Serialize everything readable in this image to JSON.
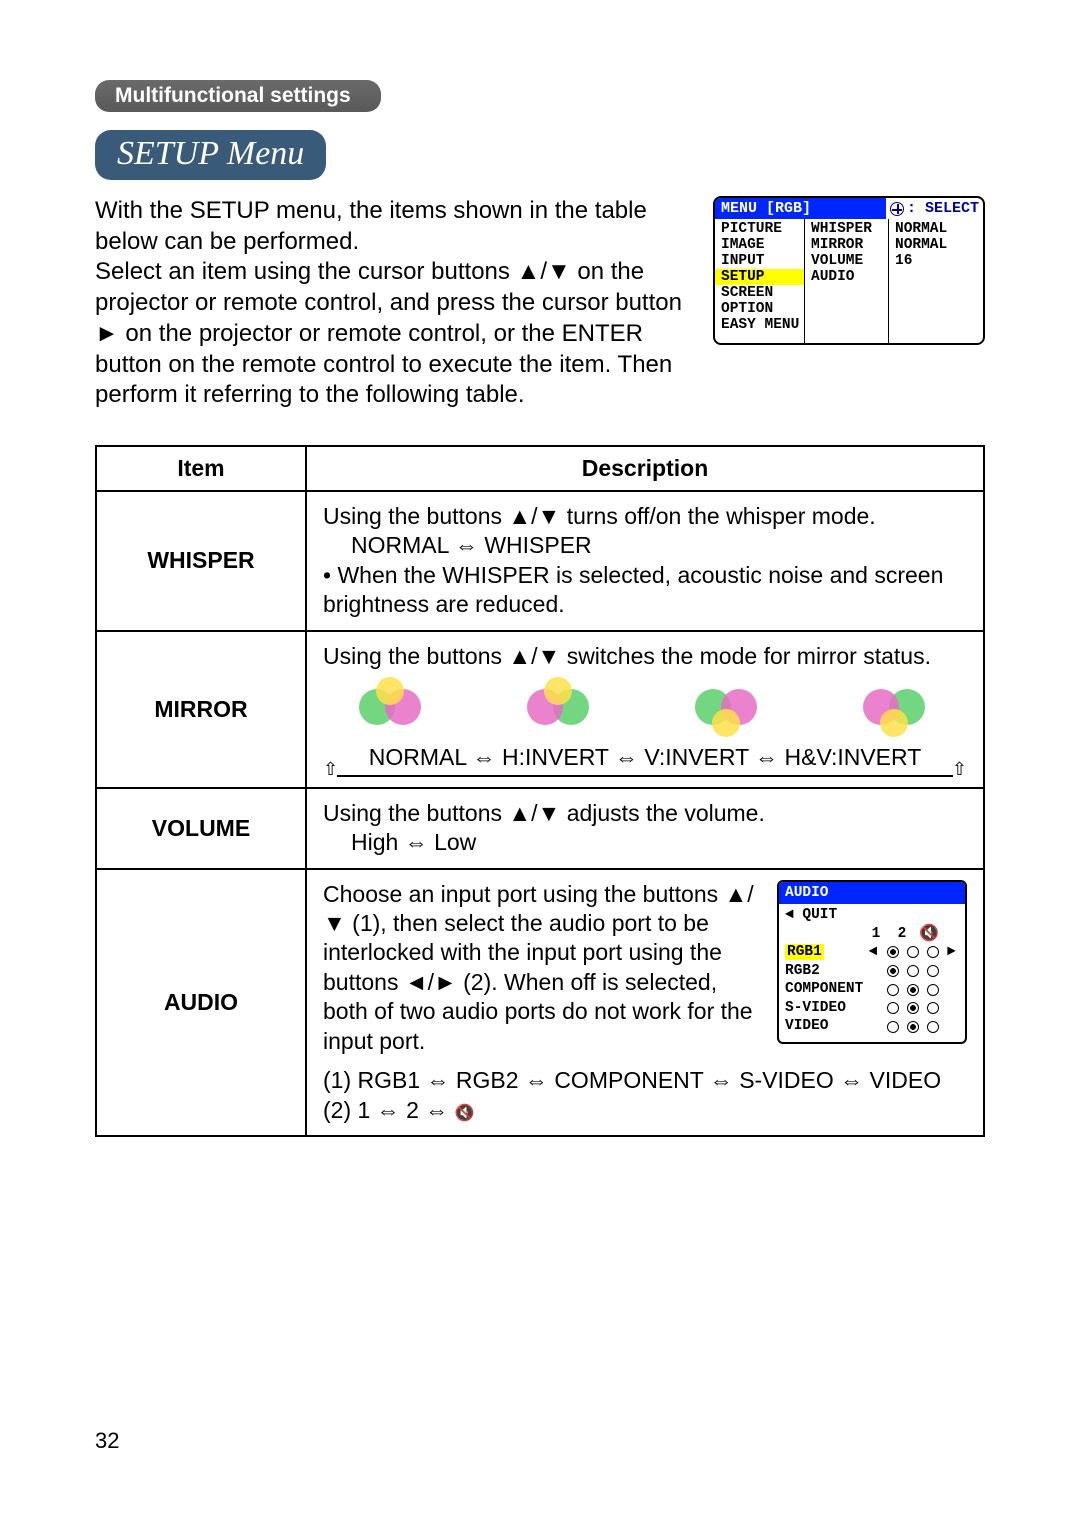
{
  "header": {
    "breadcrumb": "Multifunctional settings",
    "title": "SETUP Menu"
  },
  "intro": "With the SETUP menu, the items shown in the table below can be performed.\nSelect an item using the cursor buttons ▲/▼ on the projector or remote control, and press the cursor button ► on the projector or remote control, or the ENTER button on the remote control to execute the item. Then perform it referring to the following table.",
  "osd": {
    "menu_title": "MENU [RGB]",
    "select_label": ": SELECT",
    "left_col": [
      "PICTURE",
      "IMAGE",
      "INPUT",
      "SETUP",
      "SCREEN",
      "OPTION",
      "EASY MENU"
    ],
    "highlight": "SETUP",
    "mid_col": [
      "WHISPER",
      "MIRROR",
      "VOLUME",
      "AUDIO"
    ],
    "right_col": [
      "NORMAL",
      "NORMAL",
      "16",
      ""
    ]
  },
  "table": {
    "headers": {
      "item": "Item",
      "desc": "Description"
    },
    "rows": [
      {
        "item": "WHISPER",
        "lines": [
          "Using the buttons ▲/▼ turns off/on the whisper mode.",
          "NORMAL ⇔ WHISPER",
          "• When the WHISPER is selected, acoustic noise and screen brightness are reduced."
        ]
      },
      {
        "item": "MIRROR",
        "line1": "Using the buttons ▲/▼ switches the mode for mirror status.",
        "cycle": "NORMAL ⇔ H:INVERT ⇔ V:INVERT ⇔ H&V:INVERT"
      },
      {
        "item": "VOLUME",
        "lines": [
          "Using the buttons ▲/▼ adjusts the volume.",
          "High ⇔ Low"
        ]
      },
      {
        "item": "AUDIO",
        "text": "Choose an input port using the buttons ▲/▼ (1), then select the audio port to be interlocked with the input port using the buttons ◄/► (2). When off is selected, both of two audio ports do not work for the input port.",
        "opt1": "(1)  RGB1 ⇔ RGB2 ⇔ COMPONENT ⇔ S-VIDEO ⇔ VIDEO",
        "opt2_prefix": "(2)  1 ⇔ 2 ⇔ ",
        "osd": {
          "title": "AUDIO",
          "quit": "◄ QUIT",
          "cols": [
            "1",
            "2"
          ],
          "mute_icon": "🔇",
          "rows": [
            {
              "label": "RGB1",
              "sel": 0,
              "hl": true
            },
            {
              "label": "RGB2",
              "sel": 0
            },
            {
              "label": "COMPONENT",
              "sel": 1
            },
            {
              "label": "S-VIDEO",
              "sel": 1
            },
            {
              "label": "VIDEO",
              "sel": 1
            }
          ]
        }
      }
    ]
  },
  "page_number": "32"
}
